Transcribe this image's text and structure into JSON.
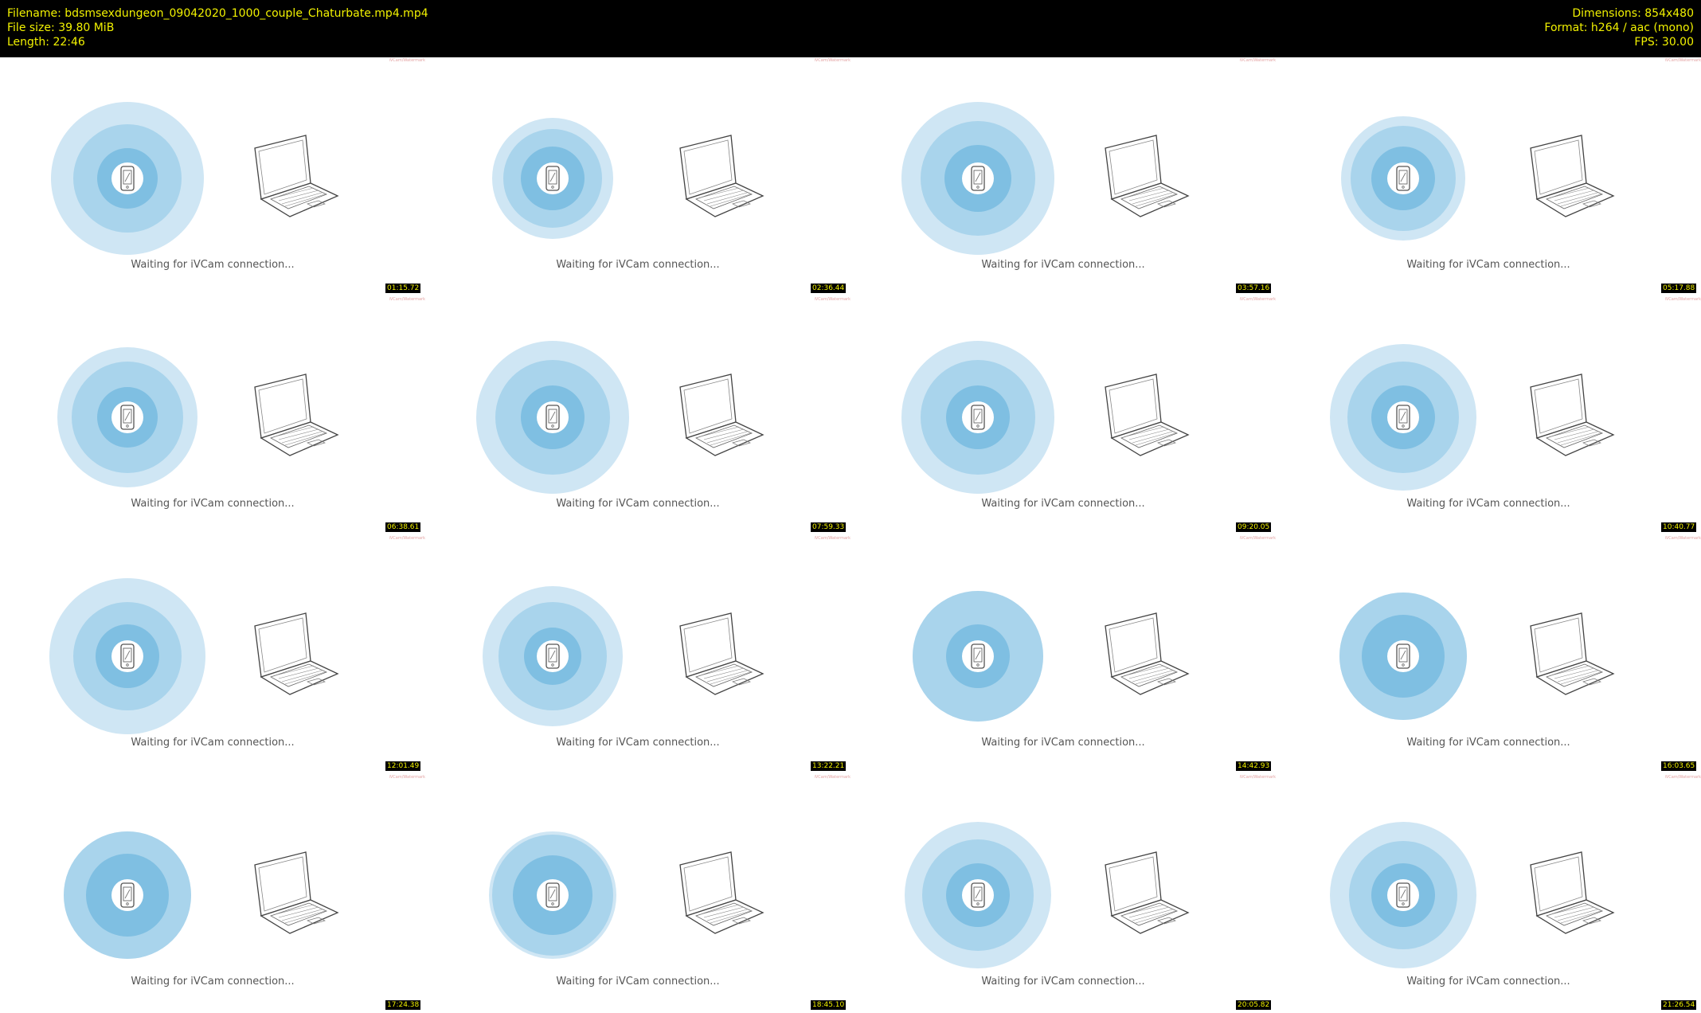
{
  "header": {
    "filename": "Filename: bdsmsexdungeon_09042020_1000_couple_Chaturbate.mp4.mp4",
    "filesize": "File size: 39.80 MiB",
    "length": "Length: 22:46",
    "dimensions": "Dimensions: 854x480",
    "format": "Format: h264 / aac (mono)",
    "fps": "FPS: 30.00"
  },
  "tile_icons": {
    "phone": "phone-icon",
    "laptop": "laptop-icon"
  },
  "colors": {
    "ring_outer": "#cfe6f4",
    "ring_mid": "#a9d4ec",
    "ring_inner": "#7fbfe2",
    "timestamp_text": "#f2f200"
  },
  "frames": [
    {
      "status": "Waiting for iVCam connection...",
      "timestamp": "01:15.72",
      "watermark": "iVCam/Watermark"
    },
    {
      "status": "Waiting for iVCam connection...",
      "timestamp": "02:36.44",
      "watermark": "iVCam/Watermark"
    },
    {
      "status": "Waiting for iVCam connection...",
      "timestamp": "03:57.16",
      "watermark": "iVCam/Watermark"
    },
    {
      "status": "Waiting for iVCam connection...",
      "timestamp": "05:17.88",
      "watermark": "iVCam/Watermark"
    },
    {
      "status": "Waiting for iVCam connection...",
      "timestamp": "06:38.61",
      "watermark": "iVCam/Watermark"
    },
    {
      "status": "Waiting for iVCam connection...",
      "timestamp": "07:59.33",
      "watermark": "iVCam/Watermark"
    },
    {
      "status": "Waiting for iVCam connection...",
      "timestamp": "09:20.05",
      "watermark": "iVCam/Watermark"
    },
    {
      "status": "Waiting for iVCam connection...",
      "timestamp": "10:40.77",
      "watermark": "iVCam/Watermark"
    },
    {
      "status": "Waiting for iVCam connection...",
      "timestamp": "12:01.49",
      "watermark": "iVCam/Watermark"
    },
    {
      "status": "Waiting for iVCam connection...",
      "timestamp": "13:22.21",
      "watermark": "iVCam/Watermark"
    },
    {
      "status": "Waiting for iVCam connection...",
      "timestamp": "14:42.93",
      "watermark": "iVCam/Watermark"
    },
    {
      "status": "Waiting for iVCam connection...",
      "timestamp": "16:03.65",
      "watermark": "iVCam/Watermark"
    },
    {
      "status": "Waiting for iVCam connection...",
      "timestamp": "17:24.38",
      "watermark": "iVCam/Watermark"
    },
    {
      "status": "Waiting for iVCam connection...",
      "timestamp": "18:45.10",
      "watermark": "iVCam/Watermark"
    },
    {
      "status": "Waiting for iVCam connection...",
      "timestamp": "20:05.82",
      "watermark": "iVCam/Watermark"
    },
    {
      "status": "Waiting for iVCam connection...",
      "timestamp": "21:26.54",
      "watermark": "iVCam/Watermark"
    }
  ]
}
